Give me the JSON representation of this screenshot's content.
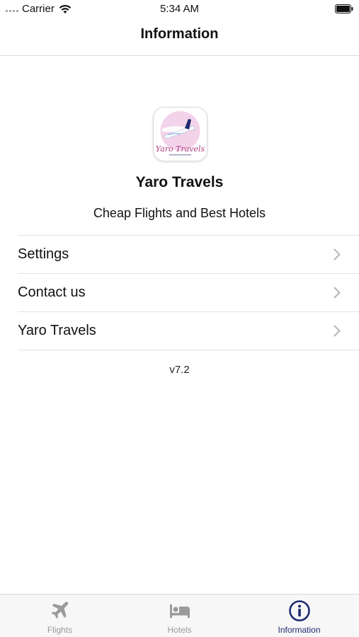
{
  "status_bar": {
    "carrier": "Carrier",
    "time": "5:34 AM"
  },
  "nav": {
    "title": "Information"
  },
  "app": {
    "logo_text": "Yaro Travels",
    "name": "Yaro Travels",
    "tagline": "Cheap Flights and Best Hotels",
    "version": "v7.2"
  },
  "menu": {
    "items": [
      {
        "label": "Settings"
      },
      {
        "label": "Contact us"
      },
      {
        "label": "Yaro Travels"
      }
    ]
  },
  "tab_bar": {
    "tabs": [
      {
        "label": "Flights",
        "icon": "airplane-icon",
        "active": false
      },
      {
        "label": "Hotels",
        "icon": "bed-icon",
        "active": false
      },
      {
        "label": "Information",
        "icon": "info-icon",
        "active": true
      }
    ]
  },
  "colors": {
    "accent": "#1f2a73",
    "inactive": "#9a9a9a",
    "logo_pink": "#e8b7d8"
  }
}
